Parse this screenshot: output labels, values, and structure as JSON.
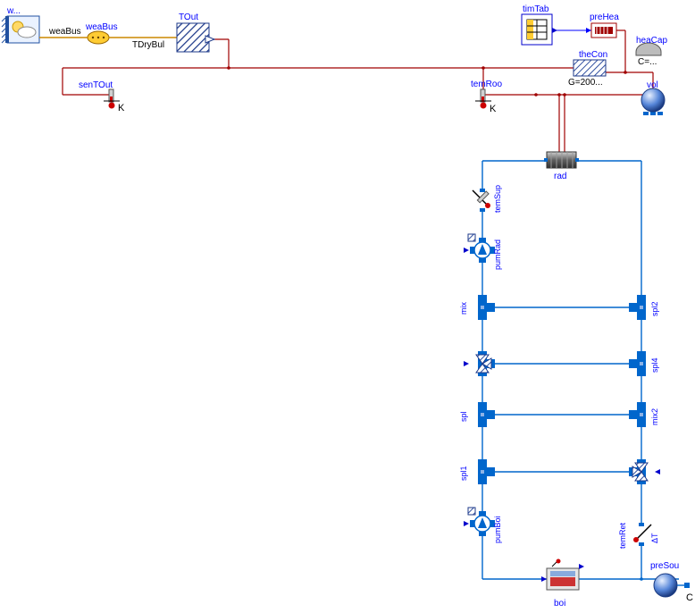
{
  "labels": {
    "w": "w...",
    "weaBus1": "weaBus",
    "weaBus2": "weaBus",
    "tDryBul": "TDryBul",
    "tOut": "TOut",
    "senTOut": "senTOut",
    "k1": "K",
    "temRoo": "temRoo",
    "k2": "K",
    "timTab": "timTab",
    "preHea": "preHea",
    "heaCap": "heaCap",
    "heaCapVal": "C=...",
    "theCon": "theCon",
    "theConVal": "G=200...",
    "vol": "vol",
    "rad": "rad",
    "temSup": "temSup",
    "pumRad": "pumRad",
    "mix": "mix",
    "spl2": "spl2",
    "spl4": "spl4",
    "mix2": "mix2",
    "spl": "spl",
    "spl1": "spl1",
    "pumBoi": "pumBoi",
    "temRet": "temRet",
    "preSou": "preSou",
    "boi": "boi",
    "deltaT": "ΔT"
  }
}
